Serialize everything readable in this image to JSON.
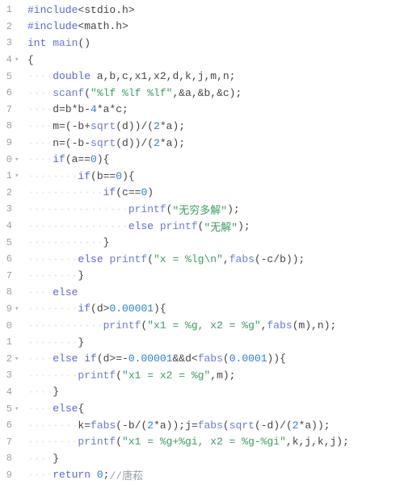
{
  "lines": [
    {
      "n": "1",
      "fold": "",
      "ws": "",
      "segs": [
        [
          "pp",
          "#include"
        ],
        [
          "id",
          "<stdio.h>"
        ]
      ]
    },
    {
      "n": "2",
      "fold": "",
      "ws": "",
      "segs": [
        [
          "pp",
          "#include"
        ],
        [
          "id",
          "<math.h>"
        ]
      ]
    },
    {
      "n": "3",
      "fold": "",
      "ws": "",
      "segs": [
        [
          "kw",
          "int"
        ],
        [
          "id",
          " "
        ],
        [
          "fn",
          "main"
        ],
        [
          "id",
          "()"
        ]
      ]
    },
    {
      "n": "4",
      "fold": "▾",
      "ws": "",
      "segs": [
        [
          "id",
          "{"
        ]
      ]
    },
    {
      "n": "5",
      "fold": "",
      "ws": "····",
      "segs": [
        [
          "kw",
          "double"
        ],
        [
          "id",
          " a,b,c,x1,x2,d,k,j,m,n;"
        ]
      ]
    },
    {
      "n": "6",
      "fold": "",
      "ws": "····",
      "segs": [
        [
          "fn",
          "scanf"
        ],
        [
          "id",
          "("
        ],
        [
          "str",
          "\"%lf %lf %lf\""
        ],
        [
          "id",
          ",&a,&b,&c);"
        ]
      ]
    },
    {
      "n": "7",
      "fold": "",
      "ws": "····",
      "segs": [
        [
          "id",
          "d=b*b-"
        ],
        [
          "num",
          "4"
        ],
        [
          "id",
          "*a*c;"
        ]
      ]
    },
    {
      "n": "8",
      "fold": "",
      "ws": "····",
      "segs": [
        [
          "id",
          "m=(-b+"
        ],
        [
          "fn",
          "sqrt"
        ],
        [
          "id",
          "(d))/("
        ],
        [
          "num",
          "2"
        ],
        [
          "id",
          "*a);"
        ]
      ]
    },
    {
      "n": "9",
      "fold": "",
      "ws": "····",
      "segs": [
        [
          "id",
          "n=(-b-"
        ],
        [
          "fn",
          "sqrt"
        ],
        [
          "id",
          "(d))/("
        ],
        [
          "num",
          "2"
        ],
        [
          "id",
          "*a);"
        ]
      ]
    },
    {
      "n": "0",
      "fold": "▾",
      "ws": "····",
      "segs": [
        [
          "kw",
          "if"
        ],
        [
          "id",
          "(a=="
        ],
        [
          "num",
          "0"
        ],
        [
          "id",
          "){"
        ]
      ]
    },
    {
      "n": "1",
      "fold": "▾",
      "ws": "········",
      "segs": [
        [
          "kw",
          "if"
        ],
        [
          "id",
          "(b=="
        ],
        [
          "num",
          "0"
        ],
        [
          "id",
          "){"
        ]
      ]
    },
    {
      "n": "2",
      "fold": "",
      "ws": "············",
      "segs": [
        [
          "kw",
          "if"
        ],
        [
          "id",
          "(c=="
        ],
        [
          "num",
          "0"
        ],
        [
          "id",
          ")"
        ]
      ]
    },
    {
      "n": "3",
      "fold": "",
      "ws": "················",
      "segs": [
        [
          "fn",
          "printf"
        ],
        [
          "id",
          "("
        ],
        [
          "str",
          "\"无穷多解\""
        ],
        [
          "id",
          ");"
        ]
      ]
    },
    {
      "n": "4",
      "fold": "",
      "ws": "················",
      "segs": [
        [
          "kw",
          "else"
        ],
        [
          "id",
          " "
        ],
        [
          "fn",
          "printf"
        ],
        [
          "id",
          "("
        ],
        [
          "str",
          "\"无解\""
        ],
        [
          "id",
          ");"
        ]
      ]
    },
    {
      "n": "5",
      "fold": "",
      "ws": "············",
      "segs": [
        [
          "id",
          "}"
        ]
      ]
    },
    {
      "n": "6",
      "fold": "",
      "ws": "········",
      "segs": [
        [
          "kw",
          "else"
        ],
        [
          "id",
          " "
        ],
        [
          "fn",
          "printf"
        ],
        [
          "id",
          "("
        ],
        [
          "str",
          "\"x = %lg\\n\""
        ],
        [
          "id",
          ","
        ],
        [
          "fn",
          "fabs"
        ],
        [
          "id",
          "(-c/b));"
        ]
      ]
    },
    {
      "n": "7",
      "fold": "",
      "ws": "········",
      "segs": [
        [
          "id",
          "}"
        ]
      ]
    },
    {
      "n": "8",
      "fold": "",
      "ws": "····",
      "segs": [
        [
          "kw",
          "else"
        ]
      ]
    },
    {
      "n": "9",
      "fold": "▾",
      "ws": "········",
      "segs": [
        [
          "kw",
          "if"
        ],
        [
          "id",
          "(d>"
        ],
        [
          "num",
          "0.00001"
        ],
        [
          "id",
          "){"
        ]
      ]
    },
    {
      "n": "0",
      "fold": "",
      "ws": "············",
      "segs": [
        [
          "fn",
          "printf"
        ],
        [
          "id",
          "("
        ],
        [
          "str",
          "\"x1 = %g, x2 = %g\""
        ],
        [
          "id",
          ","
        ],
        [
          "fn",
          "fabs"
        ],
        [
          "id",
          "(m),n);"
        ]
      ]
    },
    {
      "n": "1",
      "fold": "",
      "ws": "········",
      "segs": [
        [
          "id",
          "}"
        ]
      ]
    },
    {
      "n": "2",
      "fold": "▾",
      "ws": "····",
      "segs": [
        [
          "kw",
          "else"
        ],
        [
          "id",
          " "
        ],
        [
          "kw",
          "if"
        ],
        [
          "id",
          "(d>=-"
        ],
        [
          "num",
          "0.00001"
        ],
        [
          "id",
          "&&d<"
        ],
        [
          "fn",
          "fabs"
        ],
        [
          "id",
          "("
        ],
        [
          "num",
          "0.0001"
        ],
        [
          "id",
          ")){"
        ]
      ]
    },
    {
      "n": "3",
      "fold": "",
      "ws": "········",
      "segs": [
        [
          "fn",
          "printf"
        ],
        [
          "id",
          "("
        ],
        [
          "str",
          "\"x1 = x2 = %g\""
        ],
        [
          "id",
          ",m);"
        ]
      ]
    },
    {
      "n": "4",
      "fold": "",
      "ws": "····",
      "segs": [
        [
          "id",
          "}"
        ]
      ]
    },
    {
      "n": "5",
      "fold": "▾",
      "ws": "····",
      "segs": [
        [
          "kw",
          "else"
        ],
        [
          "id",
          "{"
        ]
      ]
    },
    {
      "n": "6",
      "fold": "",
      "ws": "········",
      "segs": [
        [
          "id",
          "k="
        ],
        [
          "fn",
          "fabs"
        ],
        [
          "id",
          "(-b/("
        ],
        [
          "num",
          "2"
        ],
        [
          "id",
          "*a));j="
        ],
        [
          "fn",
          "fabs"
        ],
        [
          "id",
          "("
        ],
        [
          "fn",
          "sqrt"
        ],
        [
          "id",
          "(-d)/("
        ],
        [
          "num",
          "2"
        ],
        [
          "id",
          "*a));"
        ]
      ]
    },
    {
      "n": "7",
      "fold": "",
      "ws": "········",
      "segs": [
        [
          "fn",
          "printf"
        ],
        [
          "id",
          "("
        ],
        [
          "str",
          "\"x1 = %g+%gi, x2 = %g-%gi\""
        ],
        [
          "id",
          ",k,j,k,j);"
        ]
      ]
    },
    {
      "n": "8",
      "fold": "",
      "ws": "····",
      "segs": [
        [
          "id",
          "}"
        ]
      ]
    },
    {
      "n": "9",
      "fold": "",
      "ws": "····",
      "segs": [
        [
          "kw",
          "return"
        ],
        [
          "id",
          " "
        ],
        [
          "num",
          "0"
        ],
        [
          "id",
          ";"
        ],
        [
          "cmt",
          "//唐菘"
        ]
      ]
    }
  ]
}
